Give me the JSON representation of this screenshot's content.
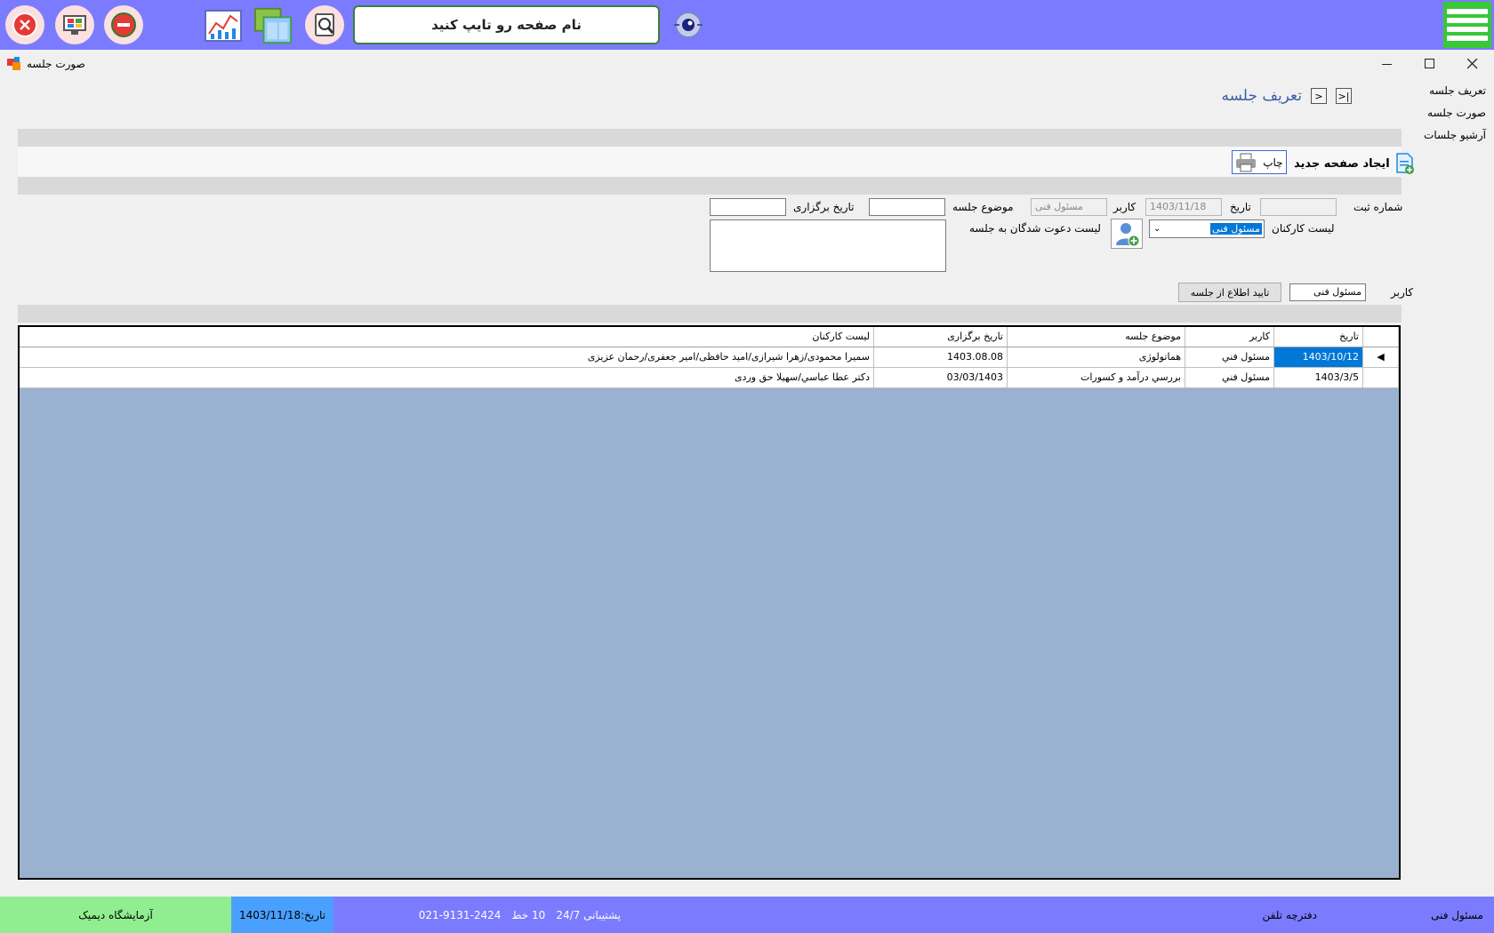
{
  "topbar": {
    "search_placeholder": "نام صفحه رو تایپ کنید",
    "icons": [
      "close-circle-icon",
      "monitor-icon",
      "minus-circle-icon",
      "chart-report-icon",
      "windows-icon",
      "search-doc-icon",
      "eye-icon",
      "hamburger-menu-icon"
    ]
  },
  "window": {
    "title": "صورت جلسه",
    "controls": [
      "minimize",
      "maximize",
      "close"
    ]
  },
  "sidenav": {
    "items": [
      {
        "label": "تعریف جلسه"
      },
      {
        "label": "صورت جلسه"
      },
      {
        "label": "آرشیو جلسات"
      }
    ]
  },
  "page": {
    "title": "تعریف جلسه"
  },
  "toolbar": {
    "new_page_label": "ایجاد صفحه جدید",
    "print_label": "چاپ"
  },
  "form": {
    "reg_no_label": "شماره ثبت",
    "reg_no_value": "",
    "date_label": "تاریخ",
    "date_value": "1403/11/18",
    "user_label": "کاربر",
    "user_value": "مسئول فنی",
    "topic_label": "موضوع جلسه",
    "topic_value": "",
    "hold_date_label": "تاریخ برگزاری",
    "hold_date_value": "",
    "staff_list_label": "لیست کارکنان",
    "staff_selected": "مسئول فنی",
    "invited_label": "لیست دعوت شدگان به جلسه",
    "filter_user_label": "کاربر",
    "filter_user_value": "مسئول فنی",
    "confirm_button": "تایید اطلاع از جلسه"
  },
  "grid": {
    "columns": [
      "تاریخ",
      "کاربر",
      "موضوع جلسه",
      "تاریخ برگزاری",
      "لیست کارکنان"
    ],
    "rows": [
      {
        "date": "1403/10/12",
        "user": "مسئول فني",
        "topic": "هماتولوژی",
        "hold_date": "1403.08.08",
        "staff": "سمیرا محمودی/زهرا شیرازی/امید حافظی/امیر جعفری/رحمان عزیزی"
      },
      {
        "date": "1403/3/5",
        "user": "مسئول فني",
        "topic": "بررسي درآمد و کسورات",
        "hold_date": "03/03/1403",
        "staff": "دکتر عطا عباسي/سهيلا حق وردی"
      }
    ]
  },
  "statusbar": {
    "user": "مسئول فنی",
    "phonebook": "دفترچه تلفن",
    "support": "پشتیبانی 24/7",
    "lines": "10 خط",
    "phone": "021-9131-2424",
    "date": "تاریخ:1403/11/18",
    "lab_name": "آزمایشگاه دیمیک",
    "colors": {
      "main": "#7b7bff",
      "date_bg": "#4aa0ff",
      "lab_bg": "#90ee90"
    }
  }
}
